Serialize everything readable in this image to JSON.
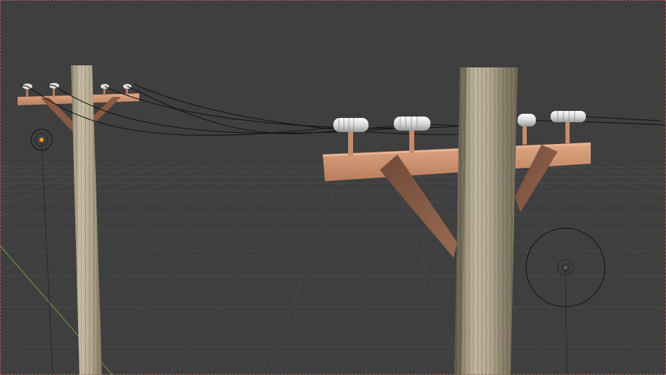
{
  "viewport": {
    "mode": "3d-viewport-solid",
    "background_color": "#3f3f3f",
    "grid_line_color": "#4a4a4a",
    "y_axis_color": "#6f8f3a",
    "selection_border_color": "#b05a5a"
  },
  "scene": {
    "objects": [
      {
        "name": "utility-pole-left",
        "material": "wood-grain"
      },
      {
        "name": "utility-pole-right",
        "material": "wood-grain"
      },
      {
        "name": "crossarm-left",
        "color": "#d39a73"
      },
      {
        "name": "crossarm-right",
        "color": "#d39a73"
      },
      {
        "name": "brace-right",
        "color": "#8a5a44"
      },
      {
        "name": "power-lines",
        "color": "#111111"
      },
      {
        "name": "glass-insulators",
        "color": "#e8e8e8"
      }
    ],
    "lights": [
      {
        "name": "point-light-left",
        "color": "#ff9a2a"
      },
      {
        "name": "point-light-right",
        "color": "#6a6a6a"
      }
    ]
  }
}
